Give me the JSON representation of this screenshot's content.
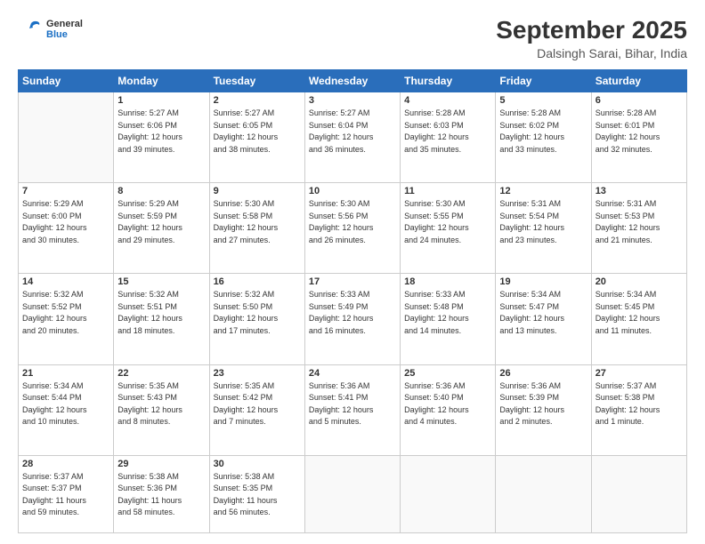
{
  "header": {
    "logo_line1": "General",
    "logo_line2": "Blue",
    "month_title": "September 2025",
    "location": "Dalsingh Sarai, Bihar, India"
  },
  "weekdays": [
    "Sunday",
    "Monday",
    "Tuesday",
    "Wednesday",
    "Thursday",
    "Friday",
    "Saturday"
  ],
  "weeks": [
    [
      {
        "day": "",
        "info": ""
      },
      {
        "day": "1",
        "info": "Sunrise: 5:27 AM\nSunset: 6:06 PM\nDaylight: 12 hours\nand 39 minutes."
      },
      {
        "day": "2",
        "info": "Sunrise: 5:27 AM\nSunset: 6:05 PM\nDaylight: 12 hours\nand 38 minutes."
      },
      {
        "day": "3",
        "info": "Sunrise: 5:27 AM\nSunset: 6:04 PM\nDaylight: 12 hours\nand 36 minutes."
      },
      {
        "day": "4",
        "info": "Sunrise: 5:28 AM\nSunset: 6:03 PM\nDaylight: 12 hours\nand 35 minutes."
      },
      {
        "day": "5",
        "info": "Sunrise: 5:28 AM\nSunset: 6:02 PM\nDaylight: 12 hours\nand 33 minutes."
      },
      {
        "day": "6",
        "info": "Sunrise: 5:28 AM\nSunset: 6:01 PM\nDaylight: 12 hours\nand 32 minutes."
      }
    ],
    [
      {
        "day": "7",
        "info": "Sunrise: 5:29 AM\nSunset: 6:00 PM\nDaylight: 12 hours\nand 30 minutes."
      },
      {
        "day": "8",
        "info": "Sunrise: 5:29 AM\nSunset: 5:59 PM\nDaylight: 12 hours\nand 29 minutes."
      },
      {
        "day": "9",
        "info": "Sunrise: 5:30 AM\nSunset: 5:58 PM\nDaylight: 12 hours\nand 27 minutes."
      },
      {
        "day": "10",
        "info": "Sunrise: 5:30 AM\nSunset: 5:56 PM\nDaylight: 12 hours\nand 26 minutes."
      },
      {
        "day": "11",
        "info": "Sunrise: 5:30 AM\nSunset: 5:55 PM\nDaylight: 12 hours\nand 24 minutes."
      },
      {
        "day": "12",
        "info": "Sunrise: 5:31 AM\nSunset: 5:54 PM\nDaylight: 12 hours\nand 23 minutes."
      },
      {
        "day": "13",
        "info": "Sunrise: 5:31 AM\nSunset: 5:53 PM\nDaylight: 12 hours\nand 21 minutes."
      }
    ],
    [
      {
        "day": "14",
        "info": "Sunrise: 5:32 AM\nSunset: 5:52 PM\nDaylight: 12 hours\nand 20 minutes."
      },
      {
        "day": "15",
        "info": "Sunrise: 5:32 AM\nSunset: 5:51 PM\nDaylight: 12 hours\nand 18 minutes."
      },
      {
        "day": "16",
        "info": "Sunrise: 5:32 AM\nSunset: 5:50 PM\nDaylight: 12 hours\nand 17 minutes."
      },
      {
        "day": "17",
        "info": "Sunrise: 5:33 AM\nSunset: 5:49 PM\nDaylight: 12 hours\nand 16 minutes."
      },
      {
        "day": "18",
        "info": "Sunrise: 5:33 AM\nSunset: 5:48 PM\nDaylight: 12 hours\nand 14 minutes."
      },
      {
        "day": "19",
        "info": "Sunrise: 5:34 AM\nSunset: 5:47 PM\nDaylight: 12 hours\nand 13 minutes."
      },
      {
        "day": "20",
        "info": "Sunrise: 5:34 AM\nSunset: 5:45 PM\nDaylight: 12 hours\nand 11 minutes."
      }
    ],
    [
      {
        "day": "21",
        "info": "Sunrise: 5:34 AM\nSunset: 5:44 PM\nDaylight: 12 hours\nand 10 minutes."
      },
      {
        "day": "22",
        "info": "Sunrise: 5:35 AM\nSunset: 5:43 PM\nDaylight: 12 hours\nand 8 minutes."
      },
      {
        "day": "23",
        "info": "Sunrise: 5:35 AM\nSunset: 5:42 PM\nDaylight: 12 hours\nand 7 minutes."
      },
      {
        "day": "24",
        "info": "Sunrise: 5:36 AM\nSunset: 5:41 PM\nDaylight: 12 hours\nand 5 minutes."
      },
      {
        "day": "25",
        "info": "Sunrise: 5:36 AM\nSunset: 5:40 PM\nDaylight: 12 hours\nand 4 minutes."
      },
      {
        "day": "26",
        "info": "Sunrise: 5:36 AM\nSunset: 5:39 PM\nDaylight: 12 hours\nand 2 minutes."
      },
      {
        "day": "27",
        "info": "Sunrise: 5:37 AM\nSunset: 5:38 PM\nDaylight: 12 hours\nand 1 minute."
      }
    ],
    [
      {
        "day": "28",
        "info": "Sunrise: 5:37 AM\nSunset: 5:37 PM\nDaylight: 11 hours\nand 59 minutes."
      },
      {
        "day": "29",
        "info": "Sunrise: 5:38 AM\nSunset: 5:36 PM\nDaylight: 11 hours\nand 58 minutes."
      },
      {
        "day": "30",
        "info": "Sunrise: 5:38 AM\nSunset: 5:35 PM\nDaylight: 11 hours\nand 56 minutes."
      },
      {
        "day": "",
        "info": ""
      },
      {
        "day": "",
        "info": ""
      },
      {
        "day": "",
        "info": ""
      },
      {
        "day": "",
        "info": ""
      }
    ]
  ]
}
